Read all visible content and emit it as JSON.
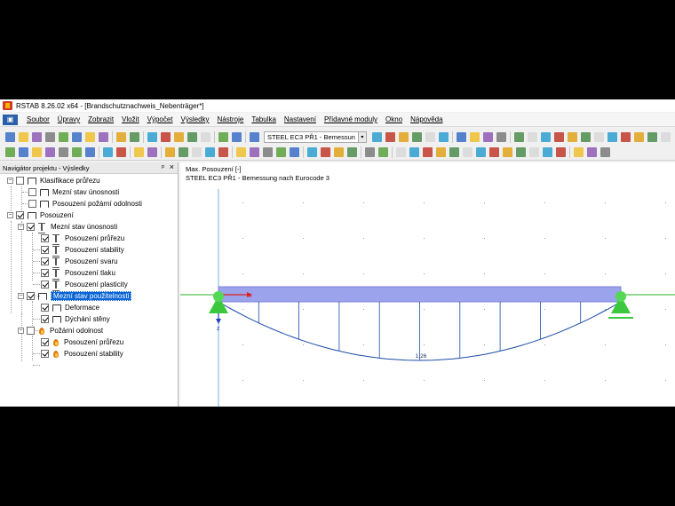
{
  "window": {
    "title": "RSTAB 8.26.02 x64 - [Brandschutznachweis_Nebenträger*]"
  },
  "menu": {
    "items": [
      "Soubor",
      "Úpravy",
      "Zobrazit",
      "Vložit",
      "Výpočet",
      "Výsledky",
      "Nástroje",
      "Tabulka",
      "Nastavení",
      "Přídavné moduly",
      "Okno",
      "Nápověda"
    ]
  },
  "toolbar": {
    "module_combo": "STEEL EC3 PŘ1 - Bemessun"
  },
  "navigator": {
    "title": "Navigátor projektu - Výsledky",
    "pin": "ᵖ",
    "close": "×",
    "items": [
      {
        "label": "Klasifikace průřezu",
        "expander": "−",
        "checked": false
      },
      {
        "label": "Mezní stav únosnosti",
        "checked": false
      },
      {
        "label": "Posouzení požární odolnosti",
        "checked": false
      },
      {
        "label": "Posouzení",
        "expander": "−",
        "checked": true
      },
      {
        "label": "Mezní stav únosnosti",
        "expander": "−",
        "checked": true
      },
      {
        "label": "Posouzení průřezu",
        "checked": true
      },
      {
        "label": "Posouzení stability",
        "checked": true
      },
      {
        "label": "Posouzení svaru",
        "checked": true
      },
      {
        "label": "Posouzení tlaku",
        "checked": true
      },
      {
        "label": "Posouzení plasticity",
        "checked": true
      },
      {
        "label": "Mezní stav použitelnosti",
        "expander": "−",
        "checked": true,
        "selected": true
      },
      {
        "label": "Deformace",
        "checked": true
      },
      {
        "label": "Dýchání stěny",
        "checked": true
      },
      {
        "label": "Požární odolnost",
        "expander": "−",
        "checked": false
      },
      {
        "label": "Posouzení průřezu",
        "checked": true
      },
      {
        "label": "Posouzení stability",
        "checked": true
      }
    ]
  },
  "canvas": {
    "line1": "Max. Posouzení [-]",
    "line2": "STEEL EC3 PŘ1 - Bemessung nach Eurocode 3",
    "max_value": "1.26",
    "axis_x": "x",
    "axis_z": "z"
  },
  "colors": {
    "beam": "#9aa3ec",
    "diagram": "#1a4ba8",
    "support": "#3cc83c",
    "axis_x": "#e02020",
    "axis_z": "#2040c0",
    "grid_line": "#2ab32a",
    "selection": "#0a64d4"
  }
}
